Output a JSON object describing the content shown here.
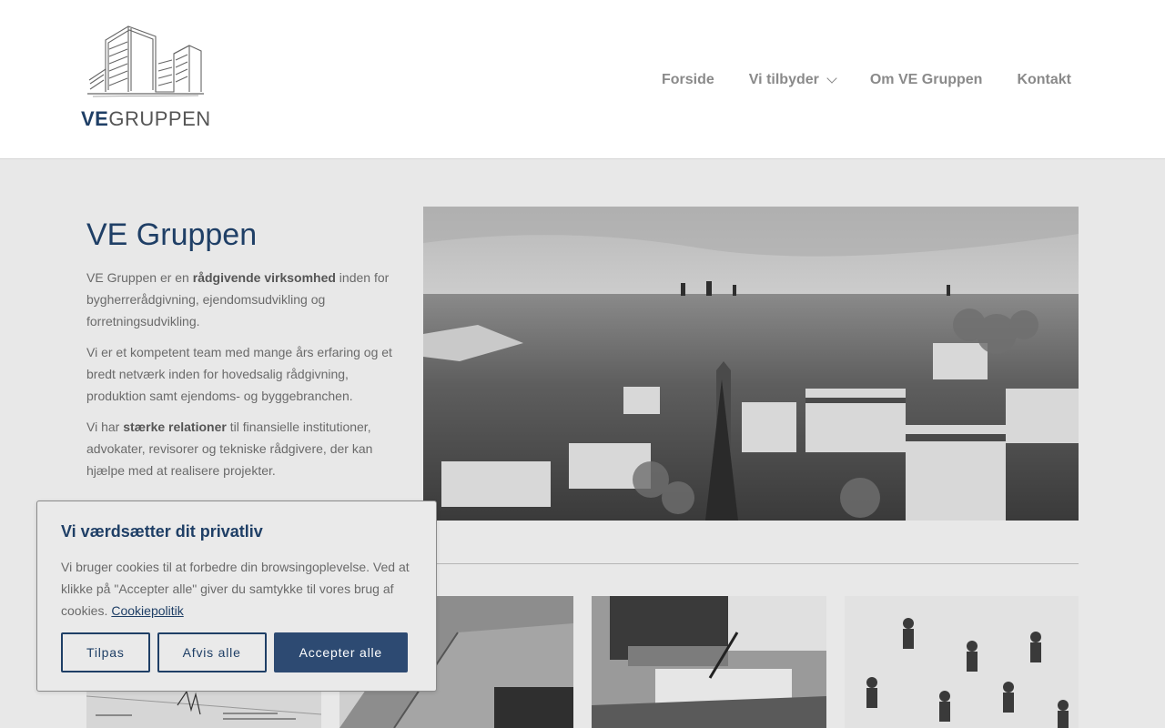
{
  "brand": {
    "logo_ve": "VE",
    "logo_gruppen": "GRUPPEN",
    "accent": "#1f3f66"
  },
  "nav": {
    "items": [
      {
        "label": "Forside"
      },
      {
        "label": "Vi tilbyder",
        "icon": "chevron-down-icon"
      },
      {
        "label": "Om VE Gruppen"
      },
      {
        "label": "Kontakt"
      }
    ]
  },
  "intro": {
    "title": "VE Gruppen",
    "p1_pre": "VE Gruppen er en ",
    "p1_bold": "rådgivende virksomhed",
    "p1_post": " inden for bygherrerådgivning, ejendomsudvikling og forretningsudvikling.",
    "p2": "Vi er et kompetent team med mange års erfaring og et bredt netværk inden for hovedsalig rådgivning, produktion samt ejendoms- og byggebranchen.",
    "p3_pre": "Vi har ",
    "p3_bold": "stærke relationer",
    "p3_post": " til finansielle institutioner, advokater, revisorer og tekniske rådgivere, der kan hjælpe med at realisere projekter."
  },
  "cookie": {
    "title": "Vi værdsætter dit privatliv",
    "text": "Vi bruger cookies til at forbedre din browsingoplevelse. Ved at klikke på \"Accepter alle\" giver du samtykke til vores brug af cookies.",
    "link": "Cookiepolitik",
    "customize": "Tilpas",
    "reject": "Afvis alle",
    "accept": "Accepter alle"
  }
}
